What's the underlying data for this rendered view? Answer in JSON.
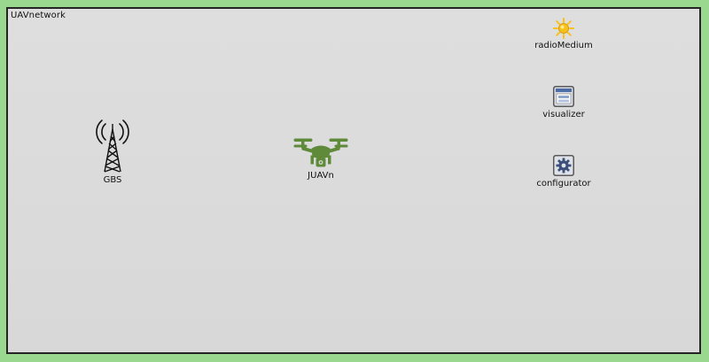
{
  "network": {
    "title": "UAVnetwork"
  },
  "modules": {
    "gbs": {
      "label": "GBS",
      "icon": "antenna-tower-icon"
    },
    "juav": {
      "label": "JUAVn",
      "icon": "drone-icon"
    },
    "radio_medium": {
      "label": "radioMedium",
      "icon": "sun-icon"
    },
    "visualizer": {
      "label": "visualizer",
      "icon": "window-icon"
    },
    "configurator": {
      "label": "configurator",
      "icon": "gear-icon"
    }
  },
  "colors": {
    "outer_background": "#9bd88f",
    "canvas_background": "#dcdcdc",
    "canvas_border": "#252525",
    "drone_green": "#5e8a3a",
    "sun_yellow": "#f5c21b"
  }
}
